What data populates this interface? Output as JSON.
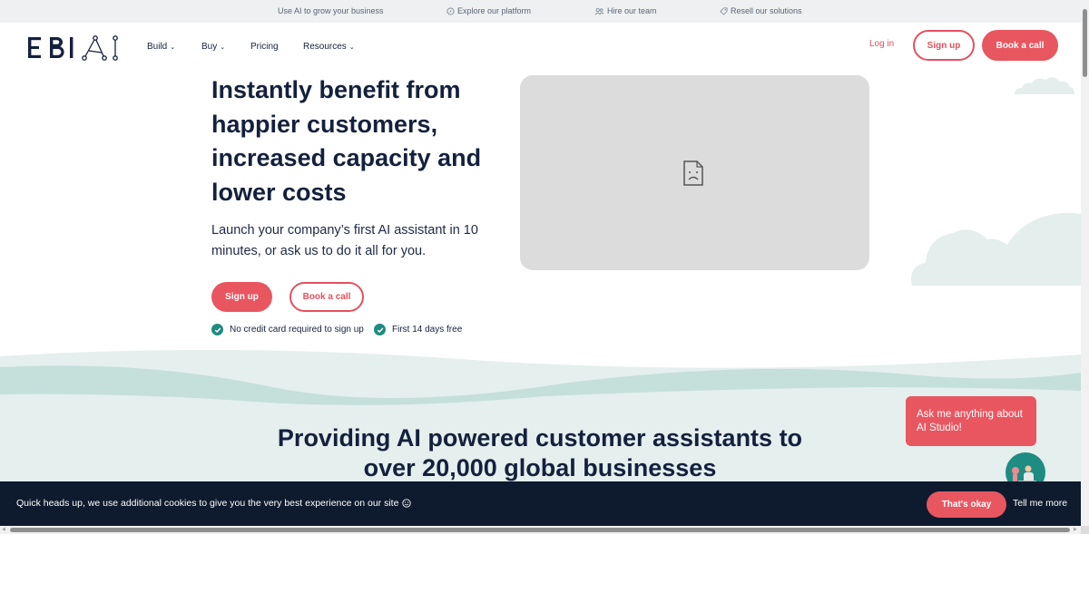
{
  "topbar": {
    "items": [
      {
        "label": "Use AI to grow your business",
        "icon": ""
      },
      {
        "label": "Explore our platform",
        "icon": "compass-icon"
      },
      {
        "label": "Hire our team",
        "icon": "team-icon"
      },
      {
        "label": "Resell our solutions",
        "icon": "tag-icon"
      }
    ]
  },
  "header": {
    "logo_text": "EBI.AI",
    "nav": [
      {
        "label": "Build",
        "has_dropdown": true
      },
      {
        "label": "Buy",
        "has_dropdown": true
      },
      {
        "label": "Pricing",
        "has_dropdown": false
      },
      {
        "label": "Resources",
        "has_dropdown": true
      }
    ],
    "login_label": "Log in",
    "signup_label": "Sign up",
    "book_label": "Book a call"
  },
  "hero": {
    "title": "Instantly benefit from happier customers, increased capacity and lower costs",
    "subtitle": "Launch your company’s first AI assistant in 10 minutes, or ask us to do it all for you.",
    "signup_label": "Sign up",
    "book_label": "Book a call",
    "checks": [
      "No credit card required to sign up",
      "First 14 days free"
    ]
  },
  "band": {
    "title": "Providing AI powered customer assistants to over 20,000 global businesses"
  },
  "chat": {
    "bubble_text": "Ask me anything about AI Studio!"
  },
  "cookie": {
    "text": "Quick heads up, we use additional cookies to give you the very best experience on our site",
    "accept_label": "That's okay",
    "more_label": "Tell me more"
  },
  "colors": {
    "accent": "#e85660",
    "navy": "#14213d",
    "teal": "#1f8c82",
    "band_light": "#e4efee",
    "band_mid": "#c5dfdb",
    "cookie_bg": "#0e1b2e"
  }
}
